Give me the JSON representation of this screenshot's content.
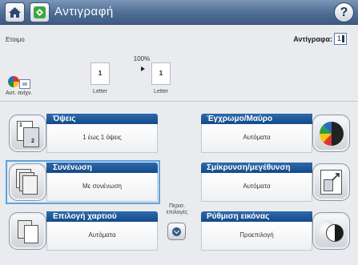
{
  "header": {
    "title": "Αντιγραφή",
    "help_glyph": "?",
    "home_icon": "home-icon",
    "copy_icon": "copy-app-icon"
  },
  "status": {
    "text": "Ετοιμο",
    "copies_label": "Αντίγραφα:",
    "copies_value": "1"
  },
  "preview": {
    "zoom": "100%",
    "source_pages": "1",
    "dest_pages": "1",
    "source_paper": "Letter",
    "dest_paper": "Letter",
    "auto_label": "Αυτ. ανίχν."
  },
  "tiles": {
    "sides": {
      "title": "Όψεις",
      "value": "1 έως 1 όψεις"
    },
    "color": {
      "title": "Έγχρωμο/Μαύρο",
      "value": "Αυτόματα"
    },
    "collate": {
      "title": "Συνένωση",
      "value": "Με συνένωση"
    },
    "reduce": {
      "title": "Σμίκρυνση/μεγέθυνση",
      "value": "Αυτόματα"
    },
    "paper": {
      "title": "Επιλογή χαρτιού",
      "value": "Αυτόματα"
    },
    "image": {
      "title": "Ρύθμιση εικόνας",
      "value": "Προεπιλογή"
    }
  },
  "more_options": "Περισ. επιλογές",
  "colors": {
    "header": "#4e6d94",
    "tile_head": "#1b5291",
    "selection": "#5aa4e3"
  }
}
